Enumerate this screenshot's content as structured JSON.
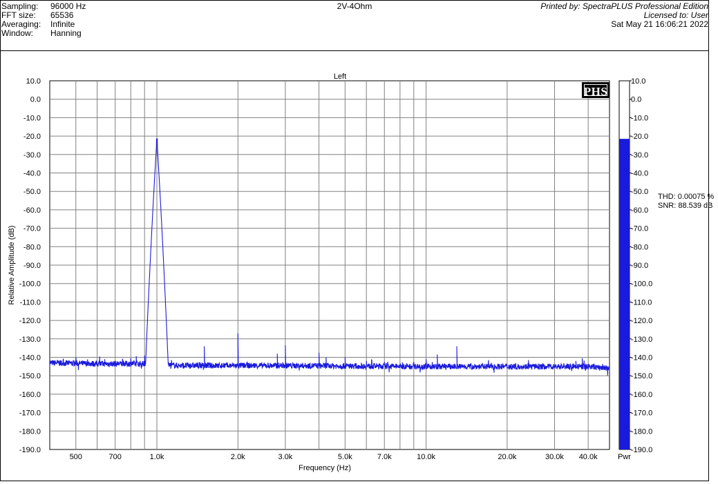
{
  "header": {
    "left": [
      {
        "label": "Sampling:",
        "value": "96000 Hz"
      },
      {
        "label": "FFT size:",
        "value": "65536"
      },
      {
        "label": "Averaging:",
        "value": "Infinite"
      },
      {
        "label": "Window:",
        "value": "Hanning"
      }
    ],
    "center": "2V-4Ohm",
    "right": [
      "Printed by: SpectraPLUS Professional Edition",
      "Licensed to: User",
      "Sat May 21 16:06:21 2022"
    ]
  },
  "logo": "PHS",
  "measurements": {
    "thd": "THD: 0.00075 %",
    "snr": "SNR: 88.539 dB"
  },
  "colors": {
    "trace": "#1a1adc",
    "grid": "#808080",
    "bar": "#1a1adc"
  },
  "chart_data": {
    "type": "line",
    "title": "Left",
    "xlabel": "Frequency (Hz)",
    "ylabel": "Relative Amplitude (dB)",
    "x_scale": "log",
    "xlim": [
      400,
      48000
    ],
    "ylim": [
      -190,
      10
    ],
    "grid": true,
    "x_tick_labels": [
      {
        "value": 500,
        "label": "500"
      },
      {
        "value": 700,
        "label": "700"
      },
      {
        "value": 1000,
        "label": "1.0k"
      },
      {
        "value": 2000,
        "label": "2.0k"
      },
      {
        "value": 3000,
        "label": "3.0k"
      },
      {
        "value": 5000,
        "label": "5.0k"
      },
      {
        "value": 7000,
        "label": "7.0k"
      },
      {
        "value": 10000,
        "label": "10.0k"
      },
      {
        "value": 20000,
        "label": "20.0k"
      },
      {
        "value": 30000,
        "label": "30.0k"
      },
      {
        "value": 40000,
        "label": "40.0k"
      }
    ],
    "x_grid_values": [
      500,
      600,
      700,
      800,
      900,
      1000,
      2000,
      3000,
      4000,
      5000,
      6000,
      7000,
      8000,
      9000,
      10000,
      20000,
      30000,
      40000
    ],
    "y_tick_labels": [
      "10.0",
      "0.0",
      "-10.0",
      "-20.0",
      "-30.0",
      "-40.0",
      "-50.0",
      "-60.0",
      "-70.0",
      "-80.0",
      "-90.0",
      "-100.0",
      "-110.0",
      "-120.0",
      "-130.0",
      "-140.0",
      "-150.0",
      "-160.0",
      "-170.0",
      "-180.0",
      "-190.0"
    ],
    "series": [
      {
        "noise_floor": [
          [
            400,
            -143
          ],
          [
            600,
            -143.5
          ],
          [
            900,
            -143.5
          ],
          [
            1200,
            -144.5
          ],
          [
            3000,
            -144.5
          ],
          [
            10000,
            -145
          ],
          [
            30000,
            -145
          ],
          [
            40000,
            -145
          ],
          [
            48000,
            -146
          ]
        ],
        "peaks": [
          {
            "freq": 1000,
            "level": -21.5,
            "width": "fundamental"
          },
          {
            "freq": 500,
            "level": -140
          },
          {
            "freq": 640,
            "level": -141
          },
          {
            "freq": 800,
            "level": -140.5
          },
          {
            "freq": 900,
            "level": -139
          },
          {
            "freq": 1500,
            "level": -134
          },
          {
            "freq": 2000,
            "level": -127
          },
          {
            "freq": 2800,
            "level": -138
          },
          {
            "freq": 3000,
            "level": -133.5
          },
          {
            "freq": 4000,
            "level": -137.5
          },
          {
            "freq": 4250,
            "level": -140
          },
          {
            "freq": 5000,
            "level": -140
          },
          {
            "freq": 6000,
            "level": -142
          },
          {
            "freq": 7000,
            "level": -142.5
          },
          {
            "freq": 9000,
            "level": -142.5
          },
          {
            "freq": 10000,
            "level": -141
          },
          {
            "freq": 11000,
            "level": -138.5
          },
          {
            "freq": 13000,
            "level": -134
          },
          {
            "freq": 24000,
            "level": -141.5
          },
          {
            "freq": 36000,
            "level": -142
          },
          {
            "freq": 38000,
            "level": -140.5
          }
        ]
      }
    ],
    "bar": {
      "label": "Pwr",
      "value": -21.5,
      "ylim": [
        -190,
        10
      ],
      "tick_labels": [
        "10.0",
        "0.0",
        "-10.0",
        "-20.0",
        "-30.0",
        "-40.0",
        "-50.0",
        "-60.0",
        "-70.0",
        "-80.0",
        "-90.0",
        "-100.0",
        "-110.0",
        "-120.0",
        "-130.0",
        "-140.0",
        "-150.0",
        "-160.0",
        "-170.0",
        "-180.0",
        "-190.0"
      ]
    }
  }
}
